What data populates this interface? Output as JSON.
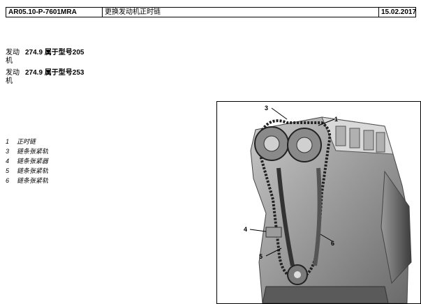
{
  "header": {
    "code": "AR05.10-P-7601MRA",
    "title": "更换发动机正时链",
    "date": "15.02.2017"
  },
  "engines": [
    {
      "label": "发动机",
      "code": "274.9",
      "text": "属于型号205"
    },
    {
      "label": "发动机",
      "code": "274.9",
      "text": "属于型号253"
    }
  ],
  "legend": [
    {
      "num": "1",
      "text": "正时链"
    },
    {
      "num": "3",
      "text": "链条张紧轨"
    },
    {
      "num": "4",
      "text": "链条张紧器"
    },
    {
      "num": "5",
      "text": "链条张紧轨"
    },
    {
      "num": "6",
      "text": "链条张紧轨"
    }
  ],
  "figure": {
    "callouts": [
      "3",
      "1",
      "4",
      "6",
      "5"
    ]
  }
}
